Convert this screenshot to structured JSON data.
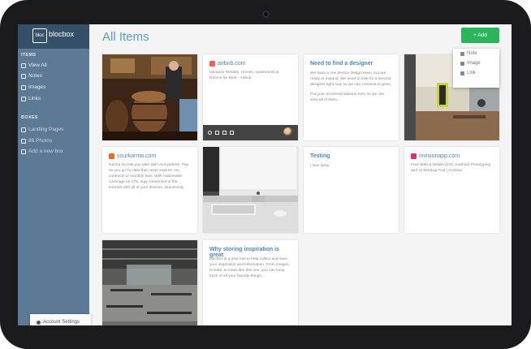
{
  "app": {
    "logo_mark": "bloc",
    "logo_text": "blocbox"
  },
  "sidebar": {
    "items_section": "ITEMS",
    "items": [
      {
        "label": "View All",
        "icon": "grid-icon"
      },
      {
        "label": "Notes",
        "icon": "pencil-icon"
      },
      {
        "label": "Images",
        "icon": "image-icon"
      },
      {
        "label": "Links",
        "icon": "link-icon"
      }
    ],
    "boxes_section": "BOXES",
    "boxes": [
      {
        "label": "Landing Pages",
        "icon": "box-icon"
      },
      {
        "label": "88 Photos",
        "icon": "box-icon"
      },
      {
        "label": "Add a new box",
        "icon": "plus-icon"
      }
    ],
    "account": "Account Settings"
  },
  "main": {
    "title": "All Items",
    "add_button": "+ Add",
    "add_menu": [
      {
        "label": "Note",
        "icon": "pencil-icon"
      },
      {
        "label": "Image",
        "icon": "image-icon"
      },
      {
        "label": "Link",
        "icon": "link-icon"
      }
    ]
  },
  "cards": {
    "airbnb": {
      "site": "airbnb.com",
      "desc": "Vacation Rentals, Homes, Apartments & Rooms for Rent - Airbnb"
    },
    "designer": {
      "title": "Need to find a designer",
      "text1": "We have a one person design team, but are ready to expand. We need to look for a second designer right now so we can continue to grow.",
      "text2": "Put your recommendations here so we can view all of them..."
    },
    "karma": {
      "site": "yourkarma.com",
      "desc": "Karma Go lets you take WiFi everywhere. Pay as you go for data that never expires. No contracts or monthly fees. With nationwide coverage on LTE, stay connected to the Internet with all of your devices, seamlessly"
    },
    "testing": {
      "title": "Testing",
      "text": "I love lamp."
    },
    "invision": {
      "site": "invisionapp.com",
      "desc": "Free Web & Mobile (iOS, Android) Prototyping and UI Mockup Tool | InVision"
    },
    "why": {
      "title": "Why storing inspiration is great",
      "text": "blocbox is a new tool to help collect and save your inspiration and information. From images, to links, to notes like this one, you can keep track of all your favorite things..."
    }
  },
  "colors": {
    "accent": "#5d9bc3",
    "sidebar": "#5c7a95",
    "sidebar_header": "#35516a",
    "add_green": "#2bb55b",
    "airbnb": "#ff5a5f",
    "karma": "#f06b22",
    "invision": "#d9317a"
  }
}
